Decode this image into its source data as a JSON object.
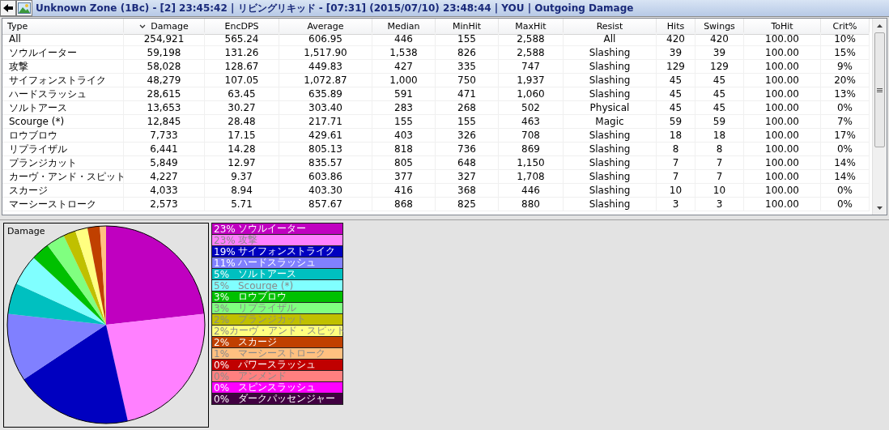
{
  "window": {
    "title": "Unknown Zone (1Bc) - [2] 23:45:42 | リビングリキッド - [07:31] (2015/07/10) 23:48:44 | YOU | Outgoing Damage"
  },
  "table": {
    "columns": [
      {
        "label": "Type",
        "sorted": false
      },
      {
        "label": "Damage",
        "sorted": true
      },
      {
        "label": "EncDPS",
        "sorted": false
      },
      {
        "label": "Average",
        "sorted": false
      },
      {
        "label": "Median",
        "sorted": false
      },
      {
        "label": "MinHit",
        "sorted": false
      },
      {
        "label": "MaxHit",
        "sorted": false
      },
      {
        "label": "Resist",
        "sorted": false
      },
      {
        "label": "Hits",
        "sorted": false
      },
      {
        "label": "Swings",
        "sorted": false
      },
      {
        "label": "ToHit",
        "sorted": false
      },
      {
        "label": "Crit%",
        "sorted": false
      }
    ],
    "rows": [
      [
        "All",
        "254,921",
        "565.24",
        "606.95",
        "446",
        "155",
        "2,588",
        "All",
        "420",
        "420",
        "100.00",
        "10%"
      ],
      [
        "ソウルイーター",
        "59,198",
        "131.26",
        "1,517.90",
        "1,538",
        "826",
        "2,588",
        "Slashing",
        "39",
        "39",
        "100.00",
        "15%"
      ],
      [
        "攻撃",
        "58,028",
        "128.67",
        "449.83",
        "427",
        "335",
        "747",
        "Slashing",
        "129",
        "129",
        "100.00",
        "9%"
      ],
      [
        "サイフォンストライク",
        "48,279",
        "107.05",
        "1,072.87",
        "1,000",
        "750",
        "1,937",
        "Slashing",
        "45",
        "45",
        "100.00",
        "20%"
      ],
      [
        "ハードスラッシュ",
        "28,615",
        "63.45",
        "635.89",
        "591",
        "471",
        "1,060",
        "Slashing",
        "45",
        "45",
        "100.00",
        "13%"
      ],
      [
        "ソルトアース",
        "13,653",
        "30.27",
        "303.40",
        "283",
        "268",
        "502",
        "Physical",
        "45",
        "45",
        "100.00",
        "0%"
      ],
      [
        "Scourge (*)",
        "12,845",
        "28.48",
        "217.71",
        "155",
        "155",
        "463",
        "Magic",
        "59",
        "59",
        "100.00",
        "7%"
      ],
      [
        "ロウブロウ",
        "7,733",
        "17.15",
        "429.61",
        "403",
        "326",
        "708",
        "Slashing",
        "18",
        "18",
        "100.00",
        "17%"
      ],
      [
        "リプライザル",
        "6,441",
        "14.28",
        "805.13",
        "818",
        "736",
        "869",
        "Slashing",
        "8",
        "8",
        "100.00",
        "0%"
      ],
      [
        "プランジカット",
        "5,849",
        "12.97",
        "835.57",
        "805",
        "648",
        "1,150",
        "Slashing",
        "7",
        "7",
        "100.00",
        "14%"
      ],
      [
        "カーヴ・アンド・スピット",
        "4,227",
        "9.37",
        "603.86",
        "377",
        "327",
        "1,708",
        "Slashing",
        "7",
        "7",
        "100.00",
        "14%"
      ],
      [
        "スカージ",
        "4,033",
        "8.94",
        "403.30",
        "416",
        "368",
        "446",
        "Slashing",
        "10",
        "10",
        "100.00",
        "0%"
      ],
      [
        "マーシーストローク",
        "2,573",
        "5.71",
        "857.67",
        "868",
        "825",
        "880",
        "Slashing",
        "3",
        "3",
        "100.00",
        "0%"
      ]
    ]
  },
  "chart": {
    "chart_data": {
      "type": "pie",
      "title": "Damage",
      "categories": [
        "ソウルイーター",
        "攻撃",
        "サイフォンストライク",
        "ハードスラッシュ",
        "ソルトアース",
        "Scourge (*)",
        "ロウブロウ",
        "リプライザル",
        "プランジカット",
        "カーヴ・アンド・スピット",
        "スカージ",
        "マーシーストローク",
        "パワースラッシュ",
        "アンメンド",
        "スピンスラッシュ",
        "ダークパッセンジャー"
      ],
      "values": [
        23,
        23,
        19,
        11,
        5,
        5,
        3,
        3,
        2,
        2,
        2,
        1,
        0,
        0,
        0,
        0
      ]
    }
  },
  "legend": [
    {
      "percent": "23%",
      "color": "#c000c0"
    },
    {
      "percent": "23%",
      "color": "#ff80ff"
    },
    {
      "percent": "19%",
      "color": "#0000c0"
    },
    {
      "percent": "11%",
      "color": "#8080ff"
    },
    {
      "percent": "5%",
      "color": "#00c0c0"
    },
    {
      "percent": "5%",
      "color": "#80ffff"
    },
    {
      "percent": "3%",
      "color": "#00c000"
    },
    {
      "percent": "3%",
      "color": "#80ff80"
    },
    {
      "percent": "2%",
      "color": "#c0c000"
    },
    {
      "percent": "2%",
      "color": "#ffff80"
    },
    {
      "percent": "2%",
      "color": "#c04000"
    },
    {
      "percent": "1%",
      "color": "#ffc080"
    },
    {
      "percent": "0%",
      "color": "#c00000"
    },
    {
      "percent": "0%",
      "color": "#ff8080"
    },
    {
      "percent": "0%",
      "color": "#ff00ff"
    },
    {
      "percent": "0%",
      "color": "#400040"
    }
  ]
}
